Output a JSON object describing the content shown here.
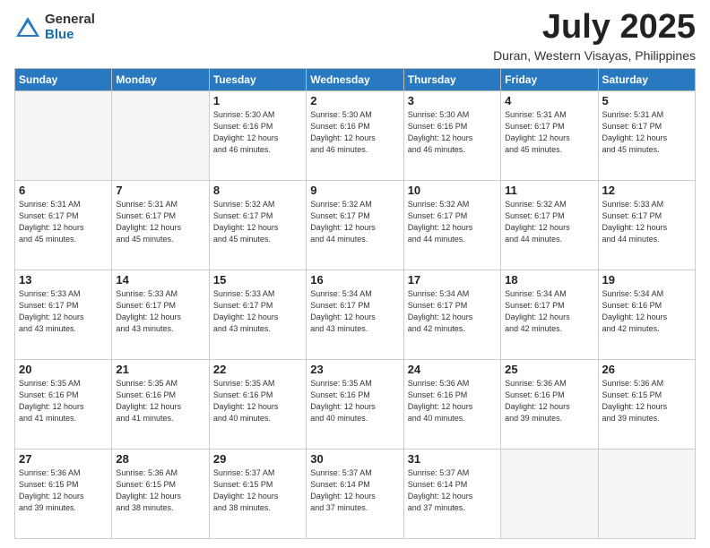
{
  "header": {
    "logo_general": "General",
    "logo_blue": "Blue",
    "title": "July 2025",
    "location": "Duran, Western Visayas, Philippines"
  },
  "days_of_week": [
    "Sunday",
    "Monday",
    "Tuesday",
    "Wednesday",
    "Thursday",
    "Friday",
    "Saturday"
  ],
  "weeks": [
    [
      {
        "day": "",
        "info": ""
      },
      {
        "day": "",
        "info": ""
      },
      {
        "day": "1",
        "info": "Sunrise: 5:30 AM\nSunset: 6:16 PM\nDaylight: 12 hours\nand 46 minutes."
      },
      {
        "day": "2",
        "info": "Sunrise: 5:30 AM\nSunset: 6:16 PM\nDaylight: 12 hours\nand 46 minutes."
      },
      {
        "day": "3",
        "info": "Sunrise: 5:30 AM\nSunset: 6:16 PM\nDaylight: 12 hours\nand 46 minutes."
      },
      {
        "day": "4",
        "info": "Sunrise: 5:31 AM\nSunset: 6:17 PM\nDaylight: 12 hours\nand 45 minutes."
      },
      {
        "day": "5",
        "info": "Sunrise: 5:31 AM\nSunset: 6:17 PM\nDaylight: 12 hours\nand 45 minutes."
      }
    ],
    [
      {
        "day": "6",
        "info": "Sunrise: 5:31 AM\nSunset: 6:17 PM\nDaylight: 12 hours\nand 45 minutes."
      },
      {
        "day": "7",
        "info": "Sunrise: 5:31 AM\nSunset: 6:17 PM\nDaylight: 12 hours\nand 45 minutes."
      },
      {
        "day": "8",
        "info": "Sunrise: 5:32 AM\nSunset: 6:17 PM\nDaylight: 12 hours\nand 45 minutes."
      },
      {
        "day": "9",
        "info": "Sunrise: 5:32 AM\nSunset: 6:17 PM\nDaylight: 12 hours\nand 44 minutes."
      },
      {
        "day": "10",
        "info": "Sunrise: 5:32 AM\nSunset: 6:17 PM\nDaylight: 12 hours\nand 44 minutes."
      },
      {
        "day": "11",
        "info": "Sunrise: 5:32 AM\nSunset: 6:17 PM\nDaylight: 12 hours\nand 44 minutes."
      },
      {
        "day": "12",
        "info": "Sunrise: 5:33 AM\nSunset: 6:17 PM\nDaylight: 12 hours\nand 44 minutes."
      }
    ],
    [
      {
        "day": "13",
        "info": "Sunrise: 5:33 AM\nSunset: 6:17 PM\nDaylight: 12 hours\nand 43 minutes."
      },
      {
        "day": "14",
        "info": "Sunrise: 5:33 AM\nSunset: 6:17 PM\nDaylight: 12 hours\nand 43 minutes."
      },
      {
        "day": "15",
        "info": "Sunrise: 5:33 AM\nSunset: 6:17 PM\nDaylight: 12 hours\nand 43 minutes."
      },
      {
        "day": "16",
        "info": "Sunrise: 5:34 AM\nSunset: 6:17 PM\nDaylight: 12 hours\nand 43 minutes."
      },
      {
        "day": "17",
        "info": "Sunrise: 5:34 AM\nSunset: 6:17 PM\nDaylight: 12 hours\nand 42 minutes."
      },
      {
        "day": "18",
        "info": "Sunrise: 5:34 AM\nSunset: 6:17 PM\nDaylight: 12 hours\nand 42 minutes."
      },
      {
        "day": "19",
        "info": "Sunrise: 5:34 AM\nSunset: 6:16 PM\nDaylight: 12 hours\nand 42 minutes."
      }
    ],
    [
      {
        "day": "20",
        "info": "Sunrise: 5:35 AM\nSunset: 6:16 PM\nDaylight: 12 hours\nand 41 minutes."
      },
      {
        "day": "21",
        "info": "Sunrise: 5:35 AM\nSunset: 6:16 PM\nDaylight: 12 hours\nand 41 minutes."
      },
      {
        "day": "22",
        "info": "Sunrise: 5:35 AM\nSunset: 6:16 PM\nDaylight: 12 hours\nand 40 minutes."
      },
      {
        "day": "23",
        "info": "Sunrise: 5:35 AM\nSunset: 6:16 PM\nDaylight: 12 hours\nand 40 minutes."
      },
      {
        "day": "24",
        "info": "Sunrise: 5:36 AM\nSunset: 6:16 PM\nDaylight: 12 hours\nand 40 minutes."
      },
      {
        "day": "25",
        "info": "Sunrise: 5:36 AM\nSunset: 6:16 PM\nDaylight: 12 hours\nand 39 minutes."
      },
      {
        "day": "26",
        "info": "Sunrise: 5:36 AM\nSunset: 6:15 PM\nDaylight: 12 hours\nand 39 minutes."
      }
    ],
    [
      {
        "day": "27",
        "info": "Sunrise: 5:36 AM\nSunset: 6:15 PM\nDaylight: 12 hours\nand 39 minutes."
      },
      {
        "day": "28",
        "info": "Sunrise: 5:36 AM\nSunset: 6:15 PM\nDaylight: 12 hours\nand 38 minutes."
      },
      {
        "day": "29",
        "info": "Sunrise: 5:37 AM\nSunset: 6:15 PM\nDaylight: 12 hours\nand 38 minutes."
      },
      {
        "day": "30",
        "info": "Sunrise: 5:37 AM\nSunset: 6:14 PM\nDaylight: 12 hours\nand 37 minutes."
      },
      {
        "day": "31",
        "info": "Sunrise: 5:37 AM\nSunset: 6:14 PM\nDaylight: 12 hours\nand 37 minutes."
      },
      {
        "day": "",
        "info": ""
      },
      {
        "day": "",
        "info": ""
      }
    ]
  ]
}
